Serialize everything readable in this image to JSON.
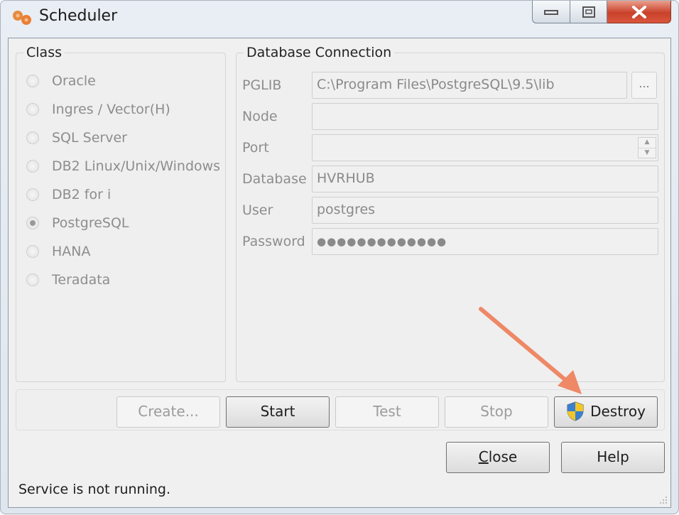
{
  "window": {
    "title": "Scheduler",
    "app_icon": "scheduler-gears-icon",
    "controls": [
      "minimize",
      "maximize",
      "close"
    ]
  },
  "class_group": {
    "title": "Class",
    "options": [
      {
        "label": "Oracle",
        "checked": false
      },
      {
        "label": "Ingres / Vector(H)",
        "checked": false
      },
      {
        "label": "SQL Server",
        "checked": false
      },
      {
        "label": "DB2 Linux/Unix/Windows",
        "checked": false
      },
      {
        "label": "DB2 for i",
        "checked": false
      },
      {
        "label": "PostgreSQL",
        "checked": true
      },
      {
        "label": "HANA",
        "checked": false
      },
      {
        "label": "Teradata",
        "checked": false
      }
    ]
  },
  "db_connection": {
    "title": "Database Connection",
    "fields": {
      "pglib": {
        "label": "PGLIB",
        "value": "C:\\Program Files\\PostgreSQL\\9.5\\lib"
      },
      "node": {
        "label": "Node",
        "value": ""
      },
      "port": {
        "label": "Port",
        "value": ""
      },
      "database": {
        "label": "Database",
        "value": "HVRHUB"
      },
      "user": {
        "label": "User",
        "value": "postgres"
      },
      "password": {
        "label": "Password",
        "value": "●●●●●●●●●●●●●"
      }
    },
    "browse_label": "..."
  },
  "actions": {
    "create": "Create...",
    "start": "Start",
    "test": "Test",
    "stop": "Stop",
    "destroy": "Destroy"
  },
  "footer": {
    "close_mnemonic": "C",
    "close_rest": "lose",
    "help": "Help"
  },
  "status": "Service is not running.",
  "colors": {
    "annotation_arrow": "#ee8866",
    "close_button": "#c9412a"
  }
}
